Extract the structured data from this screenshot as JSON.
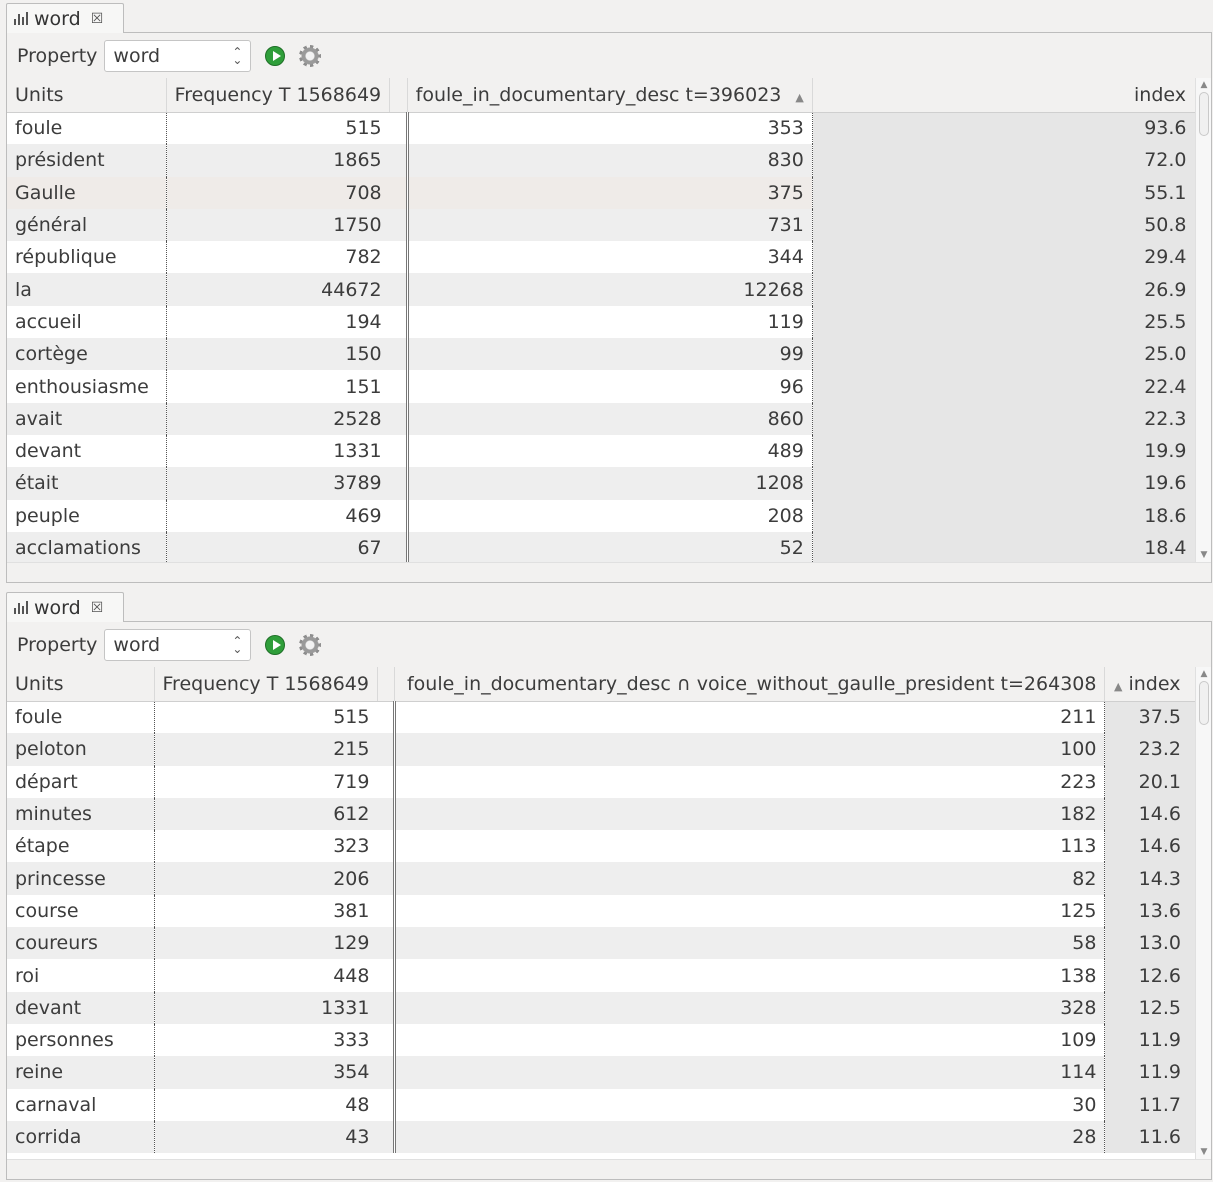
{
  "panels": [
    {
      "tab": {
        "label": "word",
        "close": "☒"
      },
      "toolbar": {
        "property_label": "Property",
        "property_value": "word"
      },
      "columns": [
        "Units",
        "Frequency T 1568649",
        "foule_in_documentary_desc t=396023",
        "index"
      ],
      "sort_indicator": "▲",
      "rows": [
        [
          "foule",
          "515",
          "353",
          "93.6"
        ],
        [
          "président",
          "1865",
          "830",
          "72.0"
        ],
        [
          "Gaulle",
          "708",
          "375",
          "55.1"
        ],
        [
          "général",
          "1750",
          "731",
          "50.8"
        ],
        [
          "république",
          "782",
          "344",
          "29.4"
        ],
        [
          "la",
          "44672",
          "12268",
          "26.9"
        ],
        [
          "accueil",
          "194",
          "119",
          "25.5"
        ],
        [
          "cortège",
          "150",
          "99",
          "25.0"
        ],
        [
          "enthousiasme",
          "151",
          "96",
          "22.4"
        ],
        [
          "avait",
          "2528",
          "860",
          "22.3"
        ],
        [
          "devant",
          "1331",
          "489",
          "19.9"
        ],
        [
          "était",
          "3789",
          "1208",
          "19.6"
        ],
        [
          "peuple",
          "469",
          "208",
          "18.6"
        ],
        [
          "acclamations",
          "67",
          "52",
          "18.4"
        ]
      ]
    },
    {
      "tab": {
        "label": "word",
        "close": "☒"
      },
      "toolbar": {
        "property_label": "Property",
        "property_value": "word"
      },
      "columns": [
        "Units",
        "Frequency T 1568649",
        "foule_in_documentary_desc ∩ voice_without_gaulle_president t=264308",
        "index"
      ],
      "sort_indicator": "▲",
      "rows": [
        [
          "foule",
          "515",
          "211",
          "37.5"
        ],
        [
          "peloton",
          "215",
          "100",
          "23.2"
        ],
        [
          "départ",
          "719",
          "223",
          "20.1"
        ],
        [
          "minutes",
          "612",
          "182",
          "14.6"
        ],
        [
          "étape",
          "323",
          "113",
          "14.6"
        ],
        [
          "princesse",
          "206",
          "82",
          "14.3"
        ],
        [
          "course",
          "381",
          "125",
          "13.6"
        ],
        [
          "coureurs",
          "129",
          "58",
          "13.0"
        ],
        [
          "roi",
          "448",
          "138",
          "12.6"
        ],
        [
          "devant",
          "1331",
          "328",
          "12.5"
        ],
        [
          "personnes",
          "333",
          "109",
          "11.9"
        ],
        [
          "reine",
          "354",
          "114",
          "11.9"
        ],
        [
          "carnaval",
          "48",
          "30",
          "11.7"
        ],
        [
          "corrida",
          "43",
          "28",
          "11.6"
        ]
      ]
    }
  ]
}
